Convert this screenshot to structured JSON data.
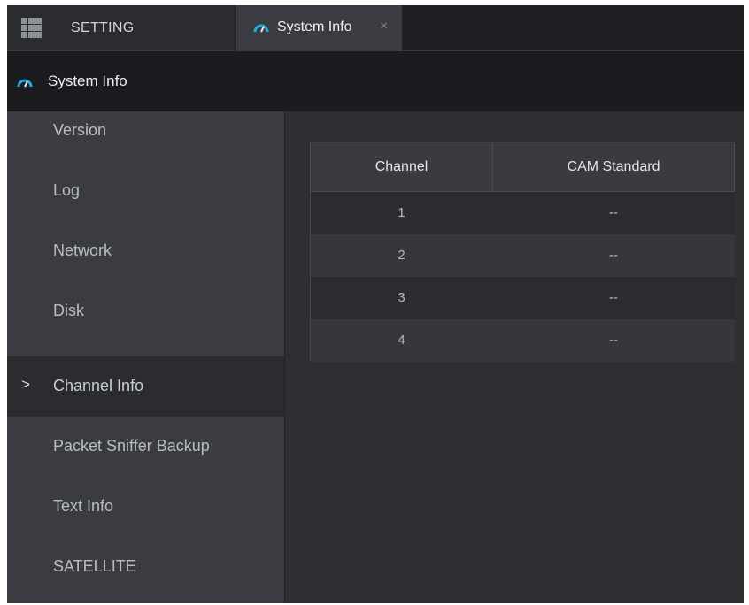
{
  "tabs": {
    "setting_label": "SETTING",
    "active_tab_label": "System Info",
    "close_glyph": "×"
  },
  "header": {
    "title": "System Info"
  },
  "sidebar": {
    "items": [
      {
        "label": "Version",
        "active": false
      },
      {
        "label": "Log",
        "active": false
      },
      {
        "label": "Network",
        "active": false
      },
      {
        "label": "Disk",
        "active": false
      },
      {
        "label": "Channel Info",
        "active": true
      },
      {
        "label": "Packet Sniffer Backup",
        "active": false
      },
      {
        "label": "Text Info",
        "active": false
      },
      {
        "label": "SATELLITE",
        "active": false
      }
    ],
    "active_marker": ">"
  },
  "table": {
    "columns": [
      "Channel",
      "CAM Standard"
    ],
    "rows": [
      [
        "1",
        "--"
      ],
      [
        "2",
        "--"
      ],
      [
        "3",
        "--"
      ],
      [
        "4",
        "--"
      ]
    ]
  },
  "colors": {
    "accent_gauge": "#29a8e0",
    "background": "#2d2f33",
    "sidebar": "#3a3c41",
    "header": "#1b1c1f"
  },
  "icons": {
    "menu": "grid-icon",
    "system_info": "gauge-icon",
    "close": "close-icon"
  }
}
